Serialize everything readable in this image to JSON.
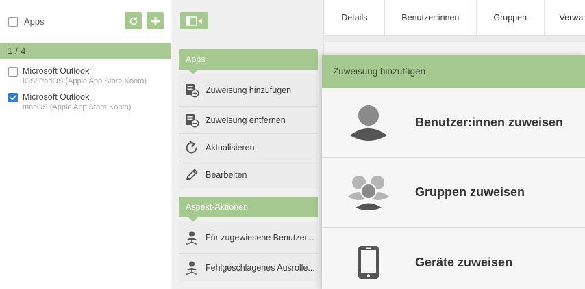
{
  "list": {
    "header_label": "Apps",
    "counter": "1 / 4",
    "items": [
      {
        "title": "Microsoft Outlook",
        "subtitle": "iOS/iPadOS (Apple App Store Konto)",
        "checked": false
      },
      {
        "title": "Microsoft Outlook",
        "subtitle": "macOS (Apple App Store Konto)",
        "checked": true
      }
    ]
  },
  "actions": {
    "apps_section": {
      "title": "Apps",
      "items": [
        {
          "label": "Zuweisung hinzufügen",
          "icon": "add-assignment-icon"
        },
        {
          "label": "Zuweisung entfernen",
          "icon": "remove-assignment-icon"
        },
        {
          "label": "Aktualisieren",
          "icon": "refresh-icon"
        },
        {
          "label": "Bearbeiten",
          "icon": "edit-pencil-icon"
        }
      ]
    },
    "aspect_section": {
      "title": "Aspekt-Aktionen",
      "items": [
        {
          "label": "Für zugewiesene Benutzer...",
          "icon": "user-branch-icon"
        },
        {
          "label": "Fehlgeschlagenes Ausrolle...",
          "icon": "user-branch-icon"
        }
      ]
    }
  },
  "tabs": [
    "Details",
    "Benutzer:innen",
    "Gruppen",
    "Verwa"
  ],
  "dialog": {
    "title": "Zuweisung hinzufügen",
    "options": [
      {
        "label": "Benutzer:innen zuweisen",
        "icon": "user-icon"
      },
      {
        "label": "Gruppen zuweisen",
        "icon": "group-icon"
      },
      {
        "label": "Geräte zuweisen",
        "icon": "smartphone-icon"
      }
    ]
  },
  "colors": {
    "accent_green": "#a5c98e",
    "checkbox_blue": "#2d7dd2"
  }
}
